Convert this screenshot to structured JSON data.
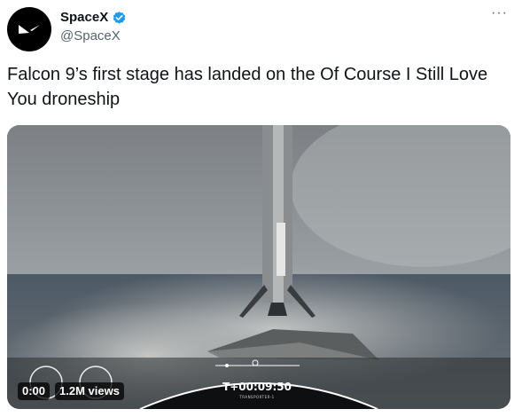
{
  "author": {
    "display_name": "SpaceX",
    "handle": "@SpaceX",
    "avatar_icon": "spacex-logo-icon",
    "verified_icon": "verified-badge-icon"
  },
  "more_menu": {
    "icon": "more-options-icon",
    "label": "···"
  },
  "tweet": {
    "text": "Falcon 9’s first stage has landed on the Of Course I Still Love You droneship"
  },
  "video": {
    "elapsed": "0:00",
    "views": "1.2M views",
    "hud_timer": "T+00:09:50",
    "hud_subtitle": "TRANSPORTER-1"
  },
  "colors": {
    "verified_blue": "#1d9bf0",
    "handle_gray": "#536471",
    "text": "#0f1419"
  }
}
